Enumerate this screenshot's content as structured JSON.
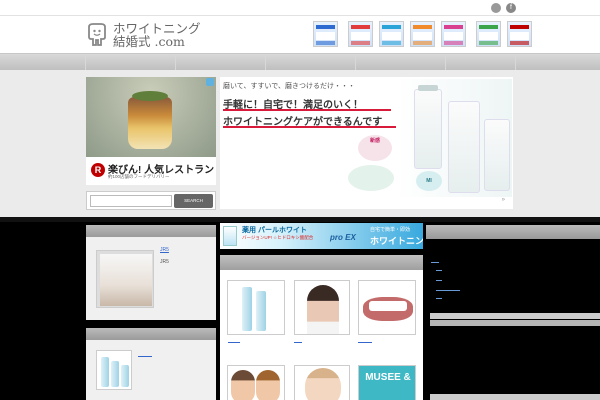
{
  "site": {
    "logo_line1": "ホワイトニング",
    "logo_line2": "結婚式 .com"
  },
  "social": {
    "rss": "",
    "facebook": "f"
  },
  "header_banners": [
    {
      "name": "banner-1",
      "color": "#2d6bd1"
    },
    {
      "name": "banner-2",
      "color": "#e23b3b"
    },
    {
      "name": "banner-3",
      "color": "#2aa3d8"
    },
    {
      "name": "banner-4",
      "color": "#f08a2a"
    },
    {
      "name": "banner-5",
      "color": "#d9408f"
    },
    {
      "name": "banner-6",
      "color": "#3aa54a"
    },
    {
      "name": "banner-7",
      "color": "#bf0000"
    }
  ],
  "ad_left": {
    "brand_icon": "R",
    "brand_text": "楽びん!",
    "headline": "人気レストラン",
    "sub": "約100店舗のフードデリバリー"
  },
  "search": {
    "placeholder": "",
    "button": "SEARCH"
  },
  "ad_main": {
    "line1": "磨いて、すすいで、磨きつけるだけ・・・",
    "line2": "手軽に！自宅で！満足のいく！",
    "line3": "ホワイトニングケアができるんです",
    "badge1": "新感",
    "badge2": "MI",
    "more_icon": "»"
  },
  "banner_mid": {
    "t1": "薬用 パールホワイト",
    "t2": "バージョンUP! ☆ヒドロキシ酸配合",
    "t3": "自宅で簡単・即効",
    "t4": "ホワイトニング",
    "proex": "pro EX"
  },
  "left_post": {
    "title": "JR5",
    "caption": "JR5"
  },
  "thumbs": [
    {
      "name": "toothpaste-thumb"
    },
    {
      "name": "woman-thumb"
    },
    {
      "name": "teeth-thumb"
    },
    {
      "name": "smile-thumb"
    },
    {
      "name": "model-thumb"
    },
    {
      "name": "musee-thumb",
      "text": "MUSEE &"
    }
  ],
  "colors": {
    "accent": "#36c",
    "rakuten": "#bf0000"
  }
}
